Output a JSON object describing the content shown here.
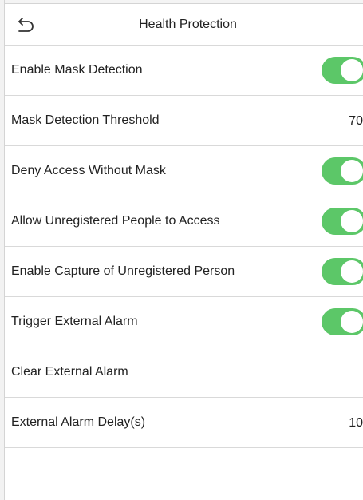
{
  "header": {
    "title": "Health Protection",
    "back_icon": "back-arrow-icon"
  },
  "colors": {
    "toggle_on": "#5cc768",
    "divider": "#d9d9d9"
  },
  "settings": {
    "enable_mask_detection": {
      "label": "Enable Mask Detection",
      "enabled": true
    },
    "mask_detection_threshold": {
      "label": "Mask Detection Threshold",
      "value": "70"
    },
    "deny_access_without_mask": {
      "label": "Deny Access Without Mask",
      "enabled": true
    },
    "allow_unregistered_access": {
      "label": "Allow Unregistered People to Access",
      "enabled": true
    },
    "enable_capture_unregistered": {
      "label": "Enable Capture of Unregistered Person",
      "enabled": true
    },
    "trigger_external_alarm": {
      "label": "Trigger External Alarm",
      "enabled": true
    },
    "clear_external_alarm": {
      "label": "Clear External Alarm"
    },
    "external_alarm_delay": {
      "label": "External Alarm Delay(s)",
      "value": "10"
    }
  }
}
